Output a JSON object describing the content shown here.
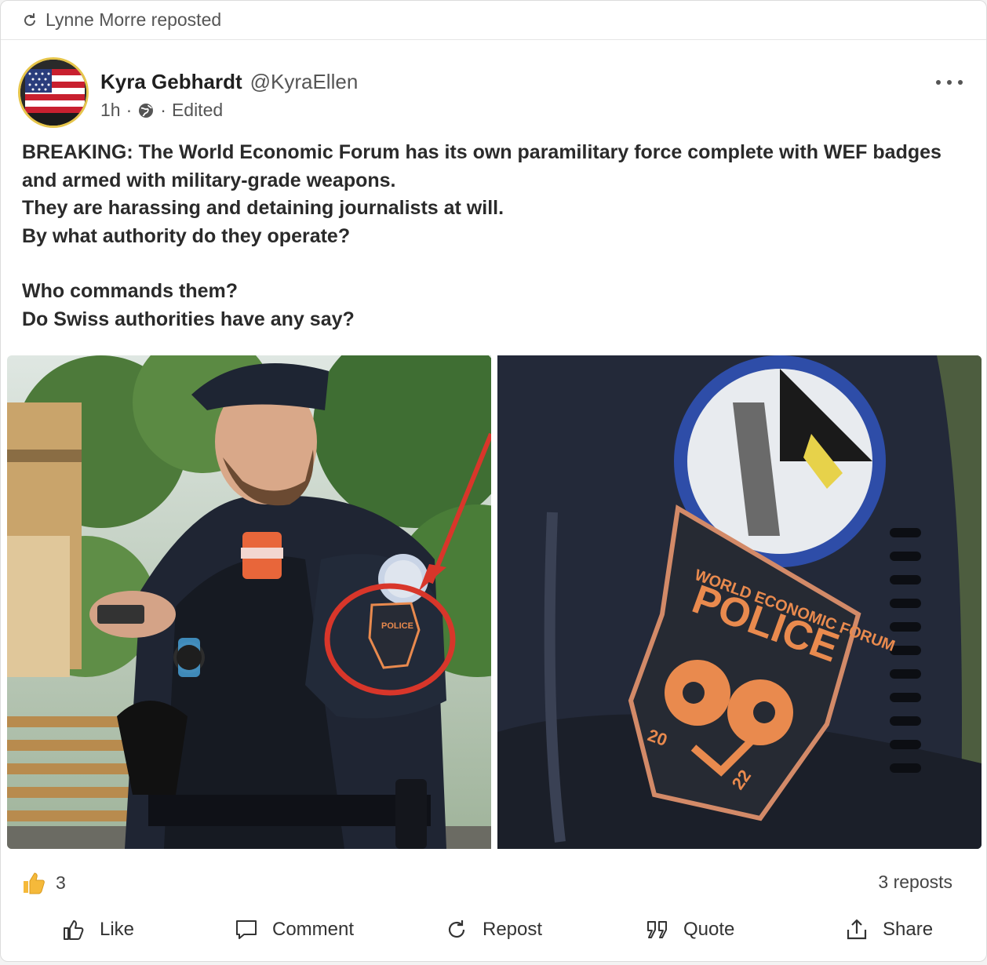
{
  "repost_banner": {
    "text": "Lynne Morre reposted",
    "icon": "repost-icon"
  },
  "author": {
    "name": "Kyra Gebhardt",
    "handle": "@KyraEllen",
    "time": "1h",
    "visibility_icon": "globe-icon",
    "edited": "Edited",
    "avatar": "american-flag-avatar"
  },
  "more_menu": {
    "icon": "more-horizontal-icon"
  },
  "post": {
    "lines": [
      "BREAKING: The World Economic Forum has its own paramilitary force complete with WEF badges and armed with military-grade weapons.",
      "They are harassing and detaining journalists at will.",
      "By what authority do they operate?",
      "",
      "Who commands them?",
      "Do Swiss authorities have any say?"
    ]
  },
  "images": [
    {
      "name": "officer-photo",
      "description_icon": "photo"
    },
    {
      "name": "patch-closeup-photo",
      "description_icon": "photo"
    }
  ],
  "image_text": {
    "patch_top": "WORLD ECONOMIC FORUM",
    "patch_main": "POLICE",
    "patch_year_left": "20",
    "patch_year_right": "22"
  },
  "stats": {
    "reaction_icon": "thumbs-up-icon",
    "reaction_count": "3",
    "reposts": "3 reposts"
  },
  "actions": [
    {
      "label": "Like",
      "icon": "like-icon"
    },
    {
      "label": "Comment",
      "icon": "comment-icon"
    },
    {
      "label": "Repost",
      "icon": "repost-icon"
    },
    {
      "label": "Quote",
      "icon": "quote-icon"
    },
    {
      "label": "Share",
      "icon": "share-icon"
    }
  ],
  "colors": {
    "avatar_ring": "#e6c54b",
    "highlight_circle": "#d8362a",
    "patch_orange": "#e98a4e",
    "thumb_yellow": "#f5b93a"
  }
}
